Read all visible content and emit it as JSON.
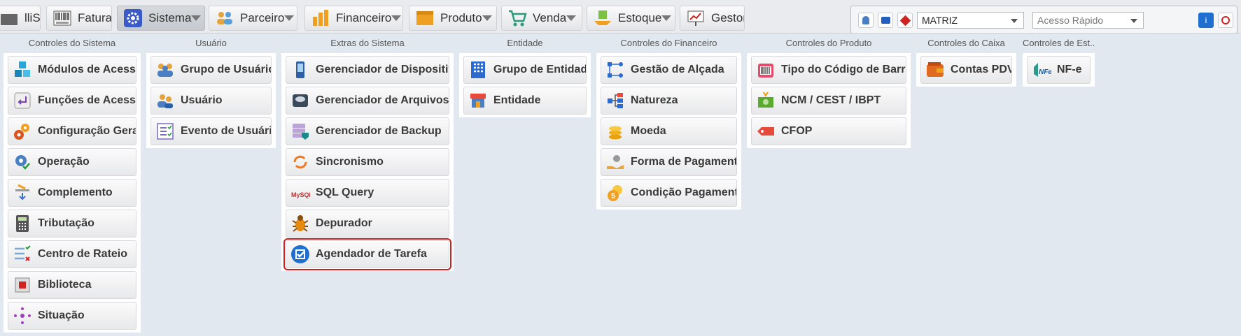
{
  "topbar": {
    "tabs": [
      {
        "key": "store",
        "label": "lliStore",
        "icon": "store-icon",
        "has_caret": false
      },
      {
        "key": "fatura",
        "label": "Fatura",
        "icon": "barcode-boleto-icon",
        "has_caret": false
      },
      {
        "key": "sistema",
        "label": "Sistema",
        "icon": "gear-icon",
        "has_caret": true,
        "active": true
      },
      {
        "key": "parceiro",
        "label": "Parceiro",
        "icon": "people-icon",
        "has_caret": true
      },
      {
        "key": "financeiro",
        "label": "Financeiro",
        "icon": "bar-chart-icon",
        "has_caret": true
      },
      {
        "key": "produto",
        "label": "Produto",
        "icon": "box-icon",
        "has_caret": true
      },
      {
        "key": "venda",
        "label": "Venda",
        "icon": "cart-icon",
        "has_caret": true
      },
      {
        "key": "estoque",
        "label": "Estoque",
        "icon": "inventory-icon",
        "has_caret": true
      },
      {
        "key": "gestor",
        "label": "Gestor",
        "icon": "presentation-board-icon",
        "has_caret": false
      }
    ],
    "company_select": "MATRIZ",
    "quick_access_placeholder": "Acesso Rápido"
  },
  "columns": [
    {
      "title": "Controles do Sistema",
      "items": [
        {
          "label": "Módulos de Acesso",
          "icon": "modules-cubes-icon"
        },
        {
          "label": "Funções de Acesso",
          "icon": "enter-key-icon"
        },
        {
          "label": "Configuração Geral",
          "icon": "gears-icon"
        },
        {
          "label": "Operação",
          "icon": "gear-check-icon"
        },
        {
          "label": "Complemento",
          "icon": "pen-arrow-icon"
        },
        {
          "label": "Tributação",
          "icon": "calculator-icon"
        },
        {
          "label": "Centro de Rateio",
          "icon": "checklist-icon"
        },
        {
          "label": "Biblioteca",
          "icon": "library-icon"
        },
        {
          "label": "Situação",
          "icon": "dots-cross-icon"
        }
      ]
    },
    {
      "title": "Usuário",
      "items": [
        {
          "label": "Grupo de Usuário",
          "icon": "user-group-icon"
        },
        {
          "label": "Usuário",
          "icon": "users-icon"
        },
        {
          "label": "Evento de Usuário",
          "icon": "event-list-icon"
        }
      ]
    },
    {
      "title": "Extras do Sistema",
      "items": [
        {
          "label": "Gerenciador de Dispositivo",
          "icon": "device-phone-icon"
        },
        {
          "label": "Gerenciador de Arquivos",
          "icon": "hard-drive-icon"
        },
        {
          "label": "Gerenciador de Backup",
          "icon": "backup-server-icon"
        },
        {
          "label": "Sincronismo",
          "icon": "sync-icon"
        },
        {
          "label": "SQL Query",
          "icon": "mysql-icon"
        },
        {
          "label": "Depurador",
          "icon": "bug-icon"
        },
        {
          "label": "Agendador de Tarefa",
          "icon": "checkbox-task-icon",
          "highlighted": true
        }
      ]
    },
    {
      "title": "Entidade",
      "items": [
        {
          "label": "Grupo de Entidade",
          "icon": "building-icon"
        },
        {
          "label": "Entidade",
          "icon": "shop-icon"
        }
      ]
    },
    {
      "title": "Controles do Financeiro",
      "items": [
        {
          "label": "Gestão de Alçada",
          "icon": "flow-nodes-icon"
        },
        {
          "label": "Natureza",
          "icon": "tree-icon"
        },
        {
          "label": "Moeda",
          "icon": "coins-icon"
        },
        {
          "label": "Forma de Pagamento",
          "icon": "hand-coin-icon"
        },
        {
          "label": "Condição Pagamento",
          "icon": "coins-five-icon"
        }
      ]
    },
    {
      "title": "Controles do Produto",
      "items": [
        {
          "label": "Tipo do Código de Barras",
          "icon": "barcode-scanner-icon"
        },
        {
          "label": "NCM / CEST / IBPT",
          "icon": "money-tag-icon"
        },
        {
          "label": "CFOP",
          "icon": "tag-icon"
        }
      ]
    },
    {
      "title": "Controles do Caixa",
      "items": [
        {
          "label": "Contas PDV",
          "icon": "wallet-icon"
        }
      ]
    },
    {
      "title": "Controles de Est...",
      "items": [
        {
          "label": "NF-e",
          "icon": "nfe-icon"
        }
      ]
    }
  ]
}
